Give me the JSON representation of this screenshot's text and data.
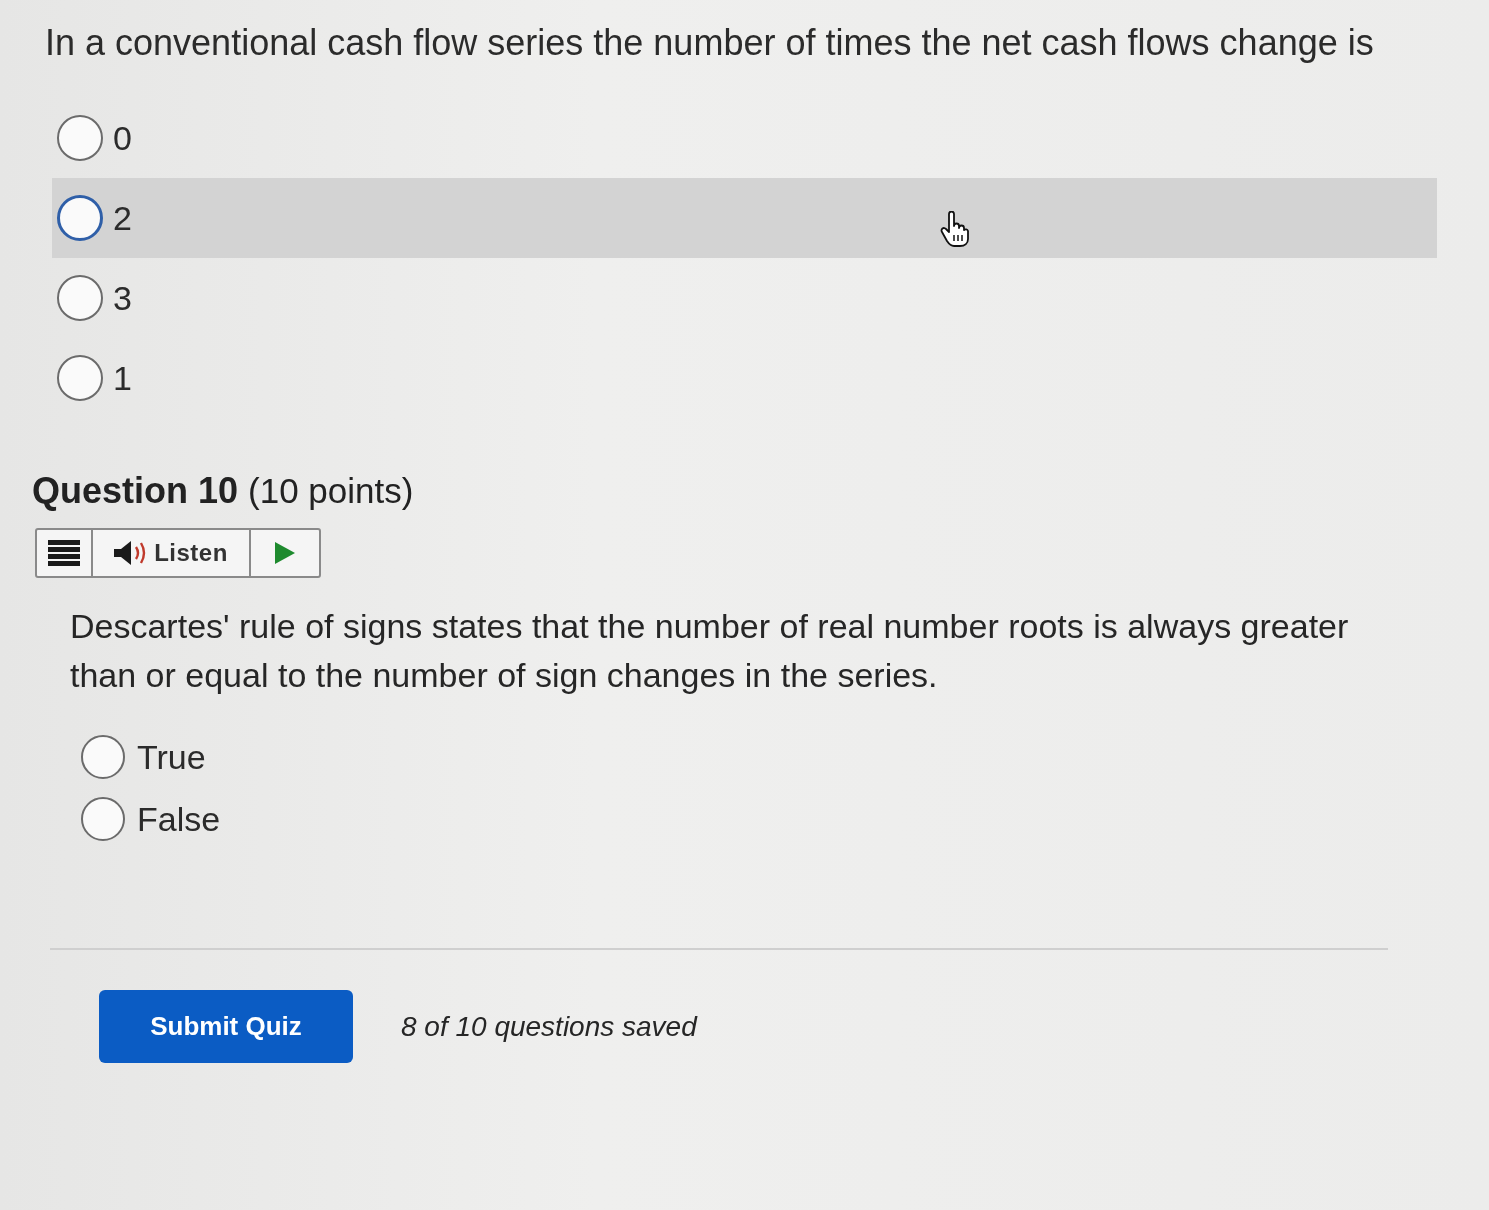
{
  "previous_question": {
    "text": "In a conventional cash flow series the number of times the net cash flows change is",
    "options": [
      {
        "label": "0",
        "selected": false,
        "hovered": false
      },
      {
        "label": "2",
        "selected": false,
        "hovered": true
      },
      {
        "label": "3",
        "selected": false,
        "hovered": false
      },
      {
        "label": "1",
        "selected": false,
        "hovered": false
      }
    ]
  },
  "question": {
    "title": "Question 10",
    "points": "(10 points)",
    "toolbar": {
      "listen_label": "Listen"
    },
    "text": "Descartes' rule of signs states that the number of real number roots is always greater than or equal to the number of sign changes in the series.",
    "options": [
      {
        "label": "True",
        "selected": false
      },
      {
        "label": "False",
        "selected": false
      }
    ]
  },
  "footer": {
    "submit_label": "Submit Quiz",
    "status": "8 of 10 questions saved"
  }
}
